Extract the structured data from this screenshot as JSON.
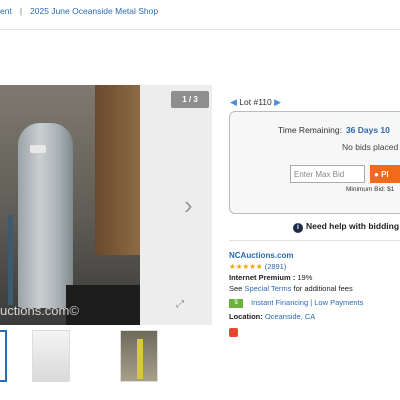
{
  "breadcrumb": {
    "prev": "ent",
    "current": "2025 June Oceanside Metal Shop"
  },
  "gallery": {
    "counter": "1 / 3",
    "watermark": "uctions.com©",
    "next_icon": "chevron-right-icon",
    "expand_icon": "expand-icon",
    "thumbnails": 3
  },
  "lot": {
    "label": "Lot #110"
  },
  "bid": {
    "time_remaining_label": "Time Remaining:",
    "time_remaining_value": "36 Days 10",
    "no_bids": "No bids placed",
    "max_bid_placeholder": "Enter Max Bid",
    "place_bid_label": "Pl",
    "min_bid": "Minimum Bid: $1"
  },
  "help": {
    "text": "Need help with bidding"
  },
  "seller": {
    "name": "NCAuctions.com",
    "stars": "★★★★★",
    "rating_count": "(2891)",
    "premium_label": "Internet Premium :",
    "premium_value": "19%",
    "terms_prefix": "See",
    "terms_link": "Special Terms",
    "terms_suffix": "for additional fees",
    "financing_link": "Instant Financing | Low Payments",
    "location_label": "Location:",
    "location_value": "Oceanside, CA"
  },
  "colors": {
    "link": "#2b6cb0",
    "bid_button": "#f06a1d",
    "stars": "#f0a500",
    "financing_badge": "#6cb33e"
  }
}
